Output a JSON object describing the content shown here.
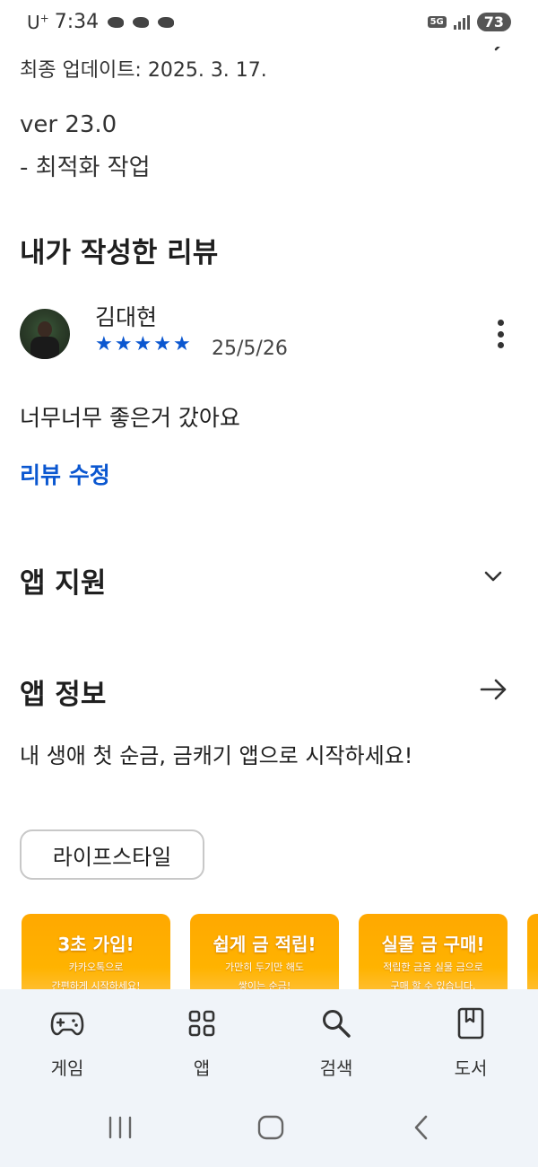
{
  "status_bar": {
    "carrier": "U",
    "carrier_sup": "+",
    "time": "7:34",
    "network": "5G",
    "battery": "73"
  },
  "whats_new": {
    "updated": "최종 업데이트: 2025. 3. 17.",
    "version": "ver 23.0",
    "note": "- 최적화 작업"
  },
  "my_review": {
    "title": "내가 작성한 리뷰",
    "reviewer": "김대현",
    "rating": 5,
    "stars": [
      "★",
      "★",
      "★",
      "★",
      "★"
    ],
    "date": "25/5/26",
    "text": "너무너무 좋은거 갔아요",
    "edit_label": "리뷰 수정"
  },
  "app_support": {
    "title": "앱 지원"
  },
  "about": {
    "title": "앱 정보",
    "description": "내 생애 첫 순금, 금캐기 앱으로 시작하세요!",
    "category_chip": "라이프스타일"
  },
  "screenshots": [
    {
      "headline": "3초 가입!",
      "sub1": "카카오톡으로",
      "sub2": "간편하게 시작하세요!"
    },
    {
      "headline": "쉽게 금 적립!",
      "sub1": "가만히 두기만 해도",
      "sub2": "쌓이는 순금!"
    },
    {
      "headline": "실물 금 구매!",
      "sub1": "적립한 금을 실물 금으로",
      "sub2": "구매 할 수 있습니다."
    }
  ],
  "bottom_nav": {
    "games": "게임",
    "apps": "앱",
    "search": "검색",
    "books": "도서"
  },
  "colors": {
    "accent": "#0b57d0",
    "nav_bg": "#f0f4f9",
    "shot_orange": "#ffa800"
  }
}
